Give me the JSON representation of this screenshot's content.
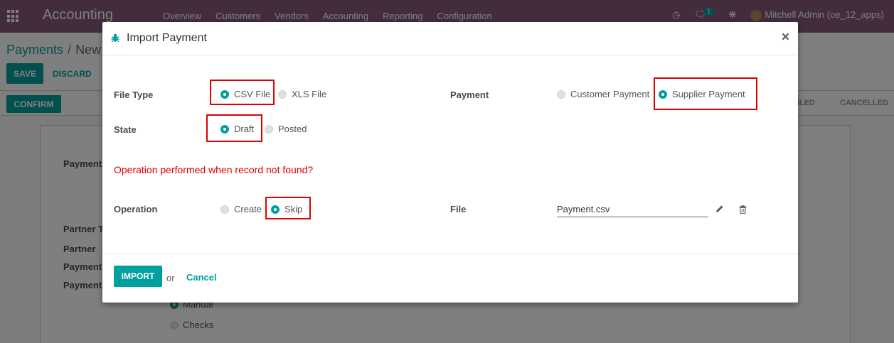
{
  "app": {
    "title": "Accounting",
    "menu": [
      "Overview",
      "Customers",
      "Vendors",
      "Accounting",
      "Reporting",
      "Configuration"
    ],
    "messages_count": "1",
    "user": "Mitchell Admin (oe_12_apps)"
  },
  "breadcrumb": {
    "parent": "Payments",
    "current": "New"
  },
  "actions": {
    "save": "SAVE",
    "discard": "DISCARD",
    "confirm": "CONFIRM"
  },
  "statusbar": {
    "stages": [
      "CILED",
      "CANCELLED"
    ]
  },
  "background_form": {
    "labels": [
      "Payment",
      "Partner T",
      "Partner",
      "Payment",
      "Payment"
    ],
    "method_options": [
      "Manual",
      "Checks"
    ]
  },
  "modal": {
    "title": "Import Payment",
    "close": "×",
    "file_type": {
      "label": "File Type",
      "options": [
        "CSV File",
        "XLS File"
      ],
      "selected": "CSV File"
    },
    "payment": {
      "label": "Payment",
      "options": [
        "Customer Payment",
        "Supplier Payment"
      ],
      "selected": "Supplier Payment"
    },
    "state": {
      "label": "State",
      "options": [
        "Draft",
        "Posted"
      ],
      "selected": "Draft"
    },
    "question": "Operation performed when record not found?",
    "operation": {
      "label": "Operation",
      "options": [
        "Create",
        "Skip"
      ],
      "selected": "Skip"
    },
    "file": {
      "label": "File",
      "value": "Payment.csv"
    },
    "footer": {
      "import": "IMPORT",
      "or": "or",
      "cancel": "Cancel"
    }
  },
  "colors": {
    "brand": "#875a7b",
    "accent": "#00a09d",
    "highlight": "#e00000"
  }
}
